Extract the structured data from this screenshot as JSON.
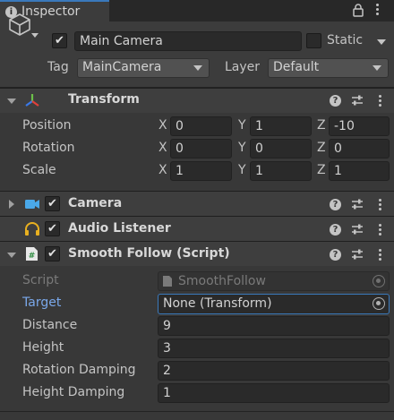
{
  "window": {
    "tab_label": "Inspector",
    "colors": {
      "background": "#383838",
      "header": "#3c3c3c",
      "field": "#2a2a2a",
      "accent": "#3a79bb",
      "highlight_label": "#7aa8ea"
    }
  },
  "gameobject": {
    "active": true,
    "name": "Main Camera",
    "static_label": "Static",
    "static_checked": false,
    "tag_label": "Tag",
    "tag_value": "MainCamera",
    "layer_label": "Layer",
    "layer_value": "Default"
  },
  "transform": {
    "title": "Transform",
    "expanded": true,
    "rows": [
      {
        "label": "Position",
        "x": "0",
        "y": "1",
        "z": "-10"
      },
      {
        "label": "Rotation",
        "x": "0",
        "y": "0",
        "z": "0"
      },
      {
        "label": "Scale",
        "x": "1",
        "y": "1",
        "z": "1"
      }
    ],
    "axis_labels": [
      "X",
      "Y",
      "Z"
    ]
  },
  "camera": {
    "title": "Camera",
    "enabled": true,
    "expanded": false
  },
  "audio_listener": {
    "title": "Audio Listener",
    "enabled": true
  },
  "smooth_follow": {
    "title": "Smooth Follow (Script)",
    "enabled": true,
    "expanded": true,
    "script_label": "Script",
    "script_value": "SmoothFollow",
    "target_label": "Target",
    "target_value": "None (Transform)",
    "fields": [
      {
        "label": "Distance",
        "value": "9"
      },
      {
        "label": "Height",
        "value": "3"
      },
      {
        "label": "Rotation Damping",
        "value": "2"
      },
      {
        "label": "Height Damping",
        "value": "1"
      }
    ]
  },
  "icons": {
    "tab": "info-icon",
    "gameobject": "cube-icon",
    "transform": "transform-axes-icon",
    "camera": "camera-icon",
    "audio_listener": "headphones-icon",
    "script": "csharp-script-icon",
    "help": "help-icon",
    "presets": "presets-icon",
    "menu": "kebab-menu-icon",
    "lock": "lock-icon",
    "object_picker": "object-picker-icon"
  }
}
